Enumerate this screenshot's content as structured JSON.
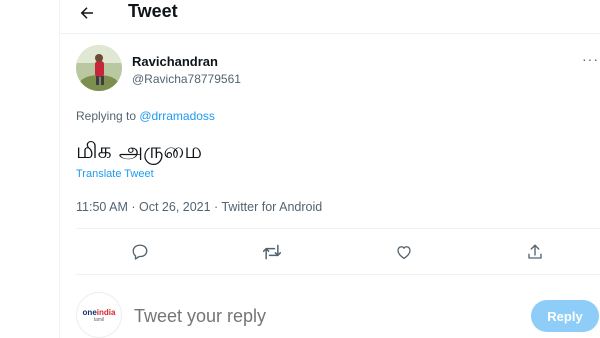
{
  "header": {
    "title": "Tweet",
    "back_icon": "arrow-left-icon"
  },
  "tweet": {
    "author_name": "Ravichandran",
    "author_handle": "@Ravicha78779561",
    "more_label": "···",
    "replying_prefix": "Replying to ",
    "replying_to": "@drramadoss",
    "text": "மிக அருமை",
    "translate_label": "Translate Tweet",
    "meta": "11:50 AM · Oct 26, 2021 · Twitter for Android"
  },
  "actions": [
    "reply-icon",
    "retweet-icon",
    "like-icon",
    "share-icon"
  ],
  "composer": {
    "placeholder": "Tweet your reply",
    "reply_label": "Reply",
    "avatar_logo_main": "one",
    "avatar_logo_accent": "india",
    "avatar_logo_sub": "tamil"
  },
  "colors": {
    "accent": "#1d9bf0",
    "reply_button_disabled": "#8ecdf8",
    "muted_text": "#536471"
  }
}
